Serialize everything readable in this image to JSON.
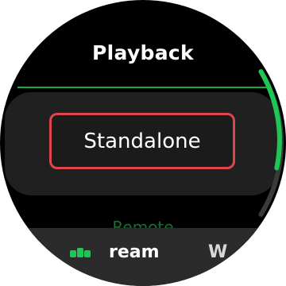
{
  "screen": {
    "title": "Playback"
  },
  "option": {
    "label": "Standalone"
  },
  "peek": {
    "label": "Remote"
  },
  "bottom_bar": {
    "item_1_label": "ream",
    "item_2_label": "W"
  },
  "scroll": {
    "position_fraction": 0.0,
    "visible_fraction": 0.45
  },
  "colors": {
    "accent_green": "#1ea84a",
    "selection_red": "#e0454c",
    "background": "#000000",
    "card": "#202020",
    "bottom_bar": "#2b2b2b"
  },
  "icons": {
    "bottom_bar_icon": "equalizer-bars-icon"
  }
}
